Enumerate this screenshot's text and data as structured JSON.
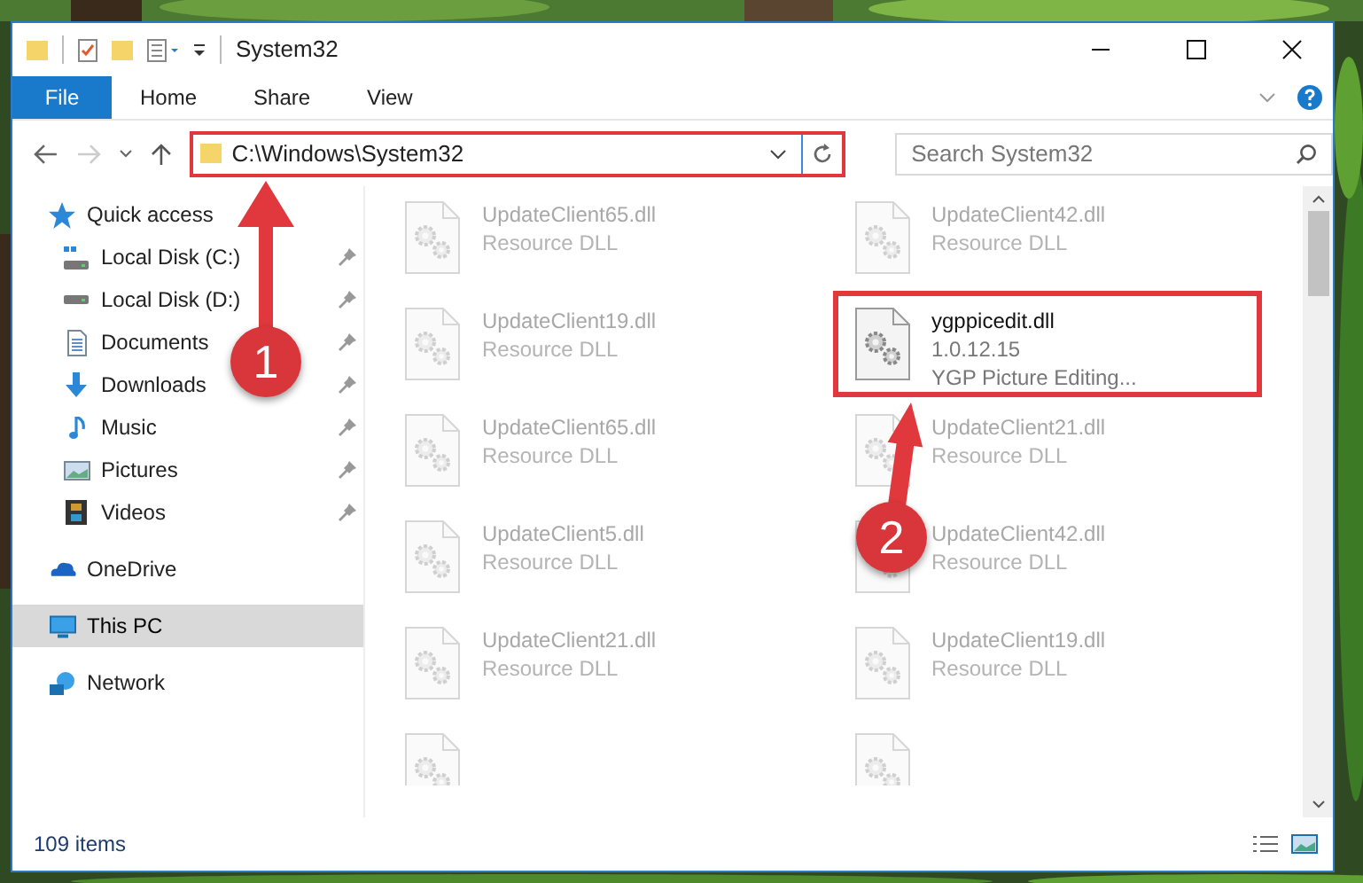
{
  "window": {
    "title": "System32"
  },
  "ribbon_tabs": [
    {
      "label": "File",
      "kind": "file_menu"
    },
    {
      "label": "Home",
      "kind": "tab"
    },
    {
      "label": "Share",
      "kind": "tab"
    },
    {
      "label": "View",
      "kind": "tab"
    }
  ],
  "address_bar": {
    "path": "C:\\Windows\\System32"
  },
  "search": {
    "placeholder": "Search System32"
  },
  "nav": [
    {
      "label": "Quick access",
      "kind": "section",
      "selected": false
    },
    {
      "label": "Local Disk (C:)",
      "kind": "item",
      "pinned": true,
      "selected": false
    },
    {
      "label": "Local Disk (D:)",
      "kind": "item",
      "pinned": true,
      "selected": false
    },
    {
      "label": "Documents",
      "kind": "item",
      "pinned": true,
      "selected": false
    },
    {
      "label": "Downloads",
      "kind": "item",
      "pinned": true,
      "selected": false
    },
    {
      "label": "Music",
      "kind": "item",
      "pinned": true,
      "selected": false
    },
    {
      "label": "Pictures",
      "kind": "item",
      "pinned": true,
      "selected": false
    },
    {
      "label": "Videos",
      "kind": "item",
      "pinned": true,
      "selected": false
    },
    {
      "label": "OneDrive",
      "kind": "section",
      "selected": false
    },
    {
      "label": "This PC",
      "kind": "section",
      "selected": true
    },
    {
      "label": "Network",
      "kind": "section",
      "selected": false
    }
  ],
  "files": [
    {
      "name": "UpdateClient65.dll",
      "detail": "Resource DLL",
      "faded": true,
      "highlighted": false
    },
    {
      "name": "UpdateClient42.dll",
      "detail": "Resource DLL",
      "faded": true,
      "highlighted": false
    },
    {
      "name": "UpdateClient19.dll",
      "detail": "Resource DLL",
      "faded": true,
      "highlighted": false
    },
    {
      "name": "ygppicedit.dll",
      "version": "1.0.12.15",
      "detail": "YGP Picture Editing...",
      "faded": false,
      "highlighted": true
    },
    {
      "name": "UpdateClient65.dll",
      "detail": "Resource DLL",
      "faded": true,
      "highlighted": false
    },
    {
      "name": "UpdateClient21.dll",
      "detail": "Resource DLL",
      "faded": true,
      "highlighted": false
    },
    {
      "name": "UpdateClient5.dll",
      "detail": "Resource DLL",
      "faded": true,
      "highlighted": false
    },
    {
      "name": "UpdateClient42.dll",
      "detail": "Resource DLL",
      "faded": true,
      "highlighted": false
    },
    {
      "name": "UpdateClient21.dll",
      "detail": "Resource DLL",
      "faded": true,
      "highlighted": false
    },
    {
      "name": "UpdateClient19.dll",
      "detail": "Resource DLL",
      "faded": true,
      "highlighted": false
    }
  ],
  "status_bar": {
    "count": "109 items"
  },
  "annotations": [
    {
      "number": "1"
    },
    {
      "number": "2"
    }
  ]
}
